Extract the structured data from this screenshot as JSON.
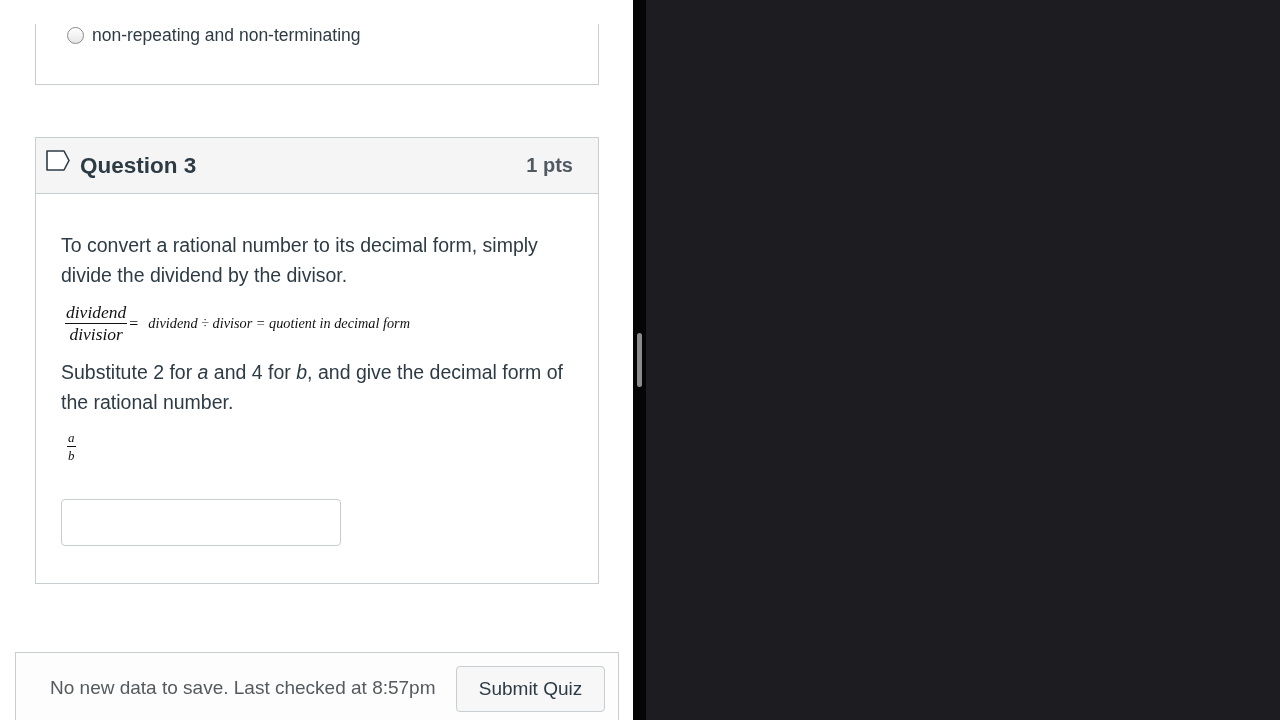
{
  "previous_question": {
    "options": [
      {
        "label": "non-repeating and non-terminating",
        "selected": false
      }
    ]
  },
  "question": {
    "title": "Question 3",
    "points": "1 pts",
    "flagged": false,
    "body": [
      {
        "kind": "text",
        "text": "To convert a rational number to its decimal form, simply divide the dividend by the divisor."
      },
      {
        "kind": "formula",
        "numerator": "dividend",
        "denominator": "divisior",
        "equals": "=",
        "expression": "dividend ÷ divisor = quotient in decimal form"
      },
      {
        "kind": "text",
        "text": "Substitute 2 for *a* and 4 for *b*, and give the decimal form of the rational number."
      },
      {
        "kind": "fraction",
        "numerator": "a",
        "denominator": "b"
      }
    ]
  },
  "footer": {
    "status": "No new data to save. Last checked at 8:57pm",
    "submit_button": "Submit Quiz"
  }
}
